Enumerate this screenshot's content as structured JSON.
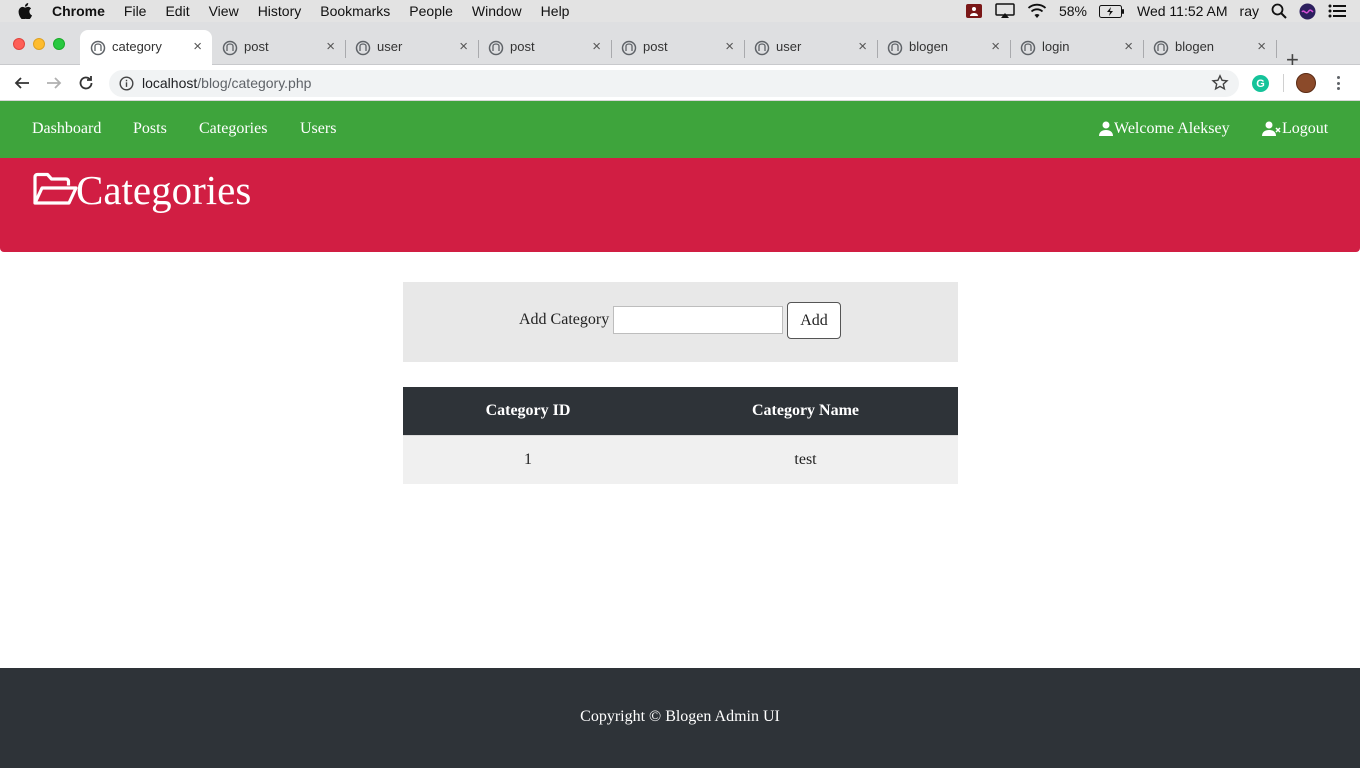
{
  "menubar": {
    "app": "Chrome",
    "items": [
      "File",
      "Edit",
      "View",
      "History",
      "Bookmarks",
      "People",
      "Window",
      "Help"
    ],
    "battery": "58%",
    "clock": "Wed 11:52 AM",
    "user": "ray"
  },
  "tabs": [
    {
      "title": "category",
      "active": true
    },
    {
      "title": "post",
      "active": false
    },
    {
      "title": "user",
      "active": false
    },
    {
      "title": "post",
      "active": false
    },
    {
      "title": "post",
      "active": false
    },
    {
      "title": "user",
      "active": false
    },
    {
      "title": "blogen",
      "active": false
    },
    {
      "title": "login",
      "active": false
    },
    {
      "title": "blogen",
      "active": false
    }
  ],
  "tab_close_glyph": "×",
  "new_tab_glyph": "+",
  "address": {
    "host": "localhost",
    "path": "/blog/category.php"
  },
  "extension": {
    "grammarly_letter": "G"
  },
  "nav": {
    "links": [
      "Dashboard",
      "Posts",
      "Categories",
      "Users"
    ],
    "welcome": "Welcome Aleksey",
    "logout": "Logout"
  },
  "colors": {
    "navbar": "#3ea43c",
    "hero": "#d11e43",
    "dark": "#2e3338"
  },
  "hero": {
    "title": "Categories",
    "icon": "folder-open-icon"
  },
  "add_form": {
    "label": "Add Category",
    "input_value": "",
    "button": "Add"
  },
  "table": {
    "headers": [
      "Category ID",
      "Category Name"
    ],
    "rows": [
      {
        "id": "1",
        "name": "test"
      }
    ]
  },
  "footer": {
    "text": "Copyright © Blogen Admin UI"
  }
}
